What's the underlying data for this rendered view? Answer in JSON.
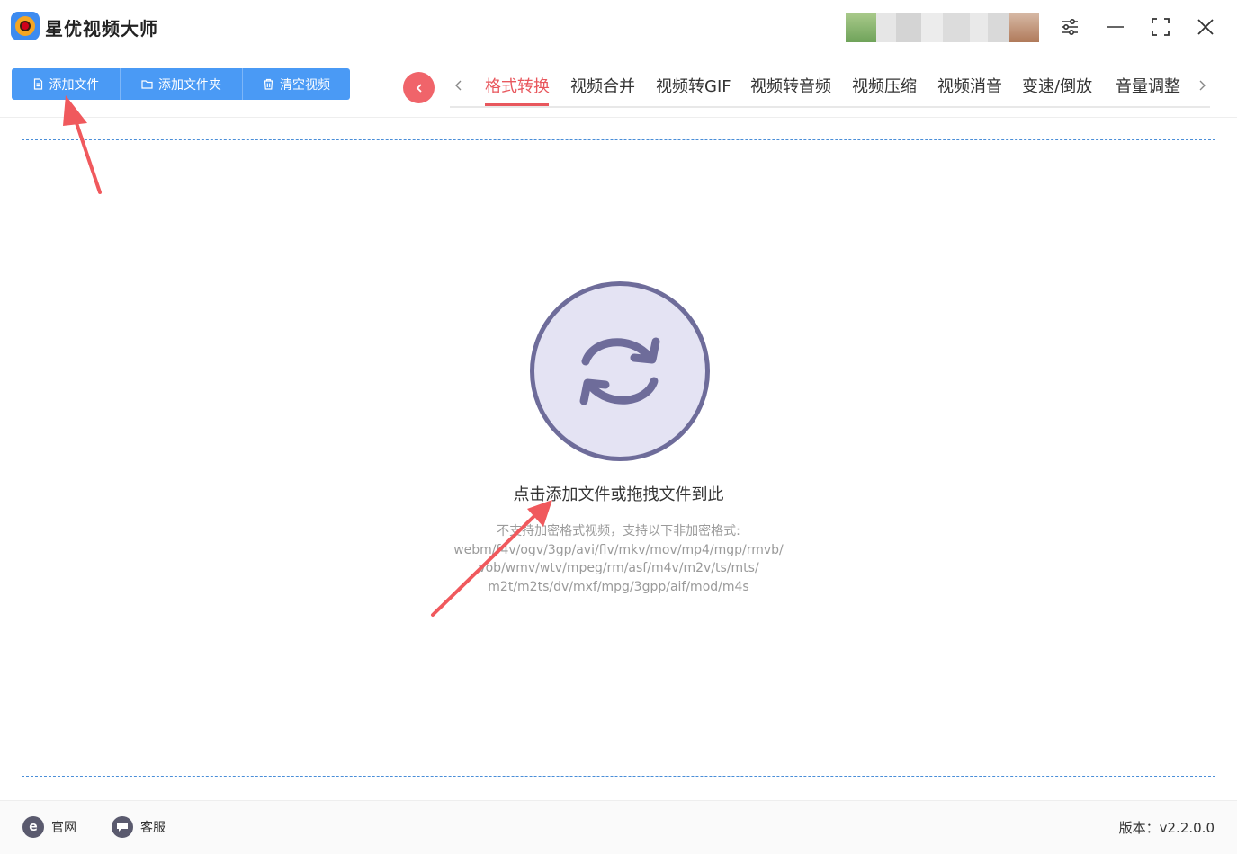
{
  "app": {
    "title": "星优视频大师"
  },
  "toolbar": {
    "add_file": "添加文件",
    "add_folder": "添加文件夹",
    "clear_videos": "清空视频"
  },
  "tabs": [
    {
      "label": "格式转换",
      "active": true
    },
    {
      "label": "视频合并",
      "active": false
    },
    {
      "label": "视频转GIF",
      "active": false
    },
    {
      "label": "视频转音频",
      "active": false
    },
    {
      "label": "视频压缩",
      "active": false
    },
    {
      "label": "视频消音",
      "active": false
    },
    {
      "label": "变速/倒放",
      "active": false
    },
    {
      "label": "音量调整",
      "active": false
    }
  ],
  "dropzone": {
    "main_text": "点击添加文件或拖拽文件到此",
    "sub_lines": [
      "不支持加密格式视频，支持以下非加密格式:",
      "webm/f4v/ogv/3gp/avi/flv/mkv/mov/mp4/mgp/rmvb/",
      "vob/wmv/wtv/mpeg/rm/asf/m4v/m2v/ts/mts/",
      "m2t/m2ts/dv/mxf/mpg/3gpp/aif/mod/m4s"
    ]
  },
  "footer": {
    "website": "官网",
    "support": "客服",
    "version": "版本：v2.2.0.0"
  },
  "colors": {
    "accent_blue": "#4a9af5",
    "accent_red": "#e8575d",
    "circle_fill": "#e4e3f3",
    "circle_stroke": "#6e6c9a",
    "annotation_arrow": "#f0595d"
  },
  "icons": {
    "logo": "app-logo-icon",
    "settings": "sliders-icon",
    "minimize": "minimize-icon",
    "maximize": "fullscreen-icon",
    "close": "close-icon",
    "convert": "refresh-icon"
  }
}
